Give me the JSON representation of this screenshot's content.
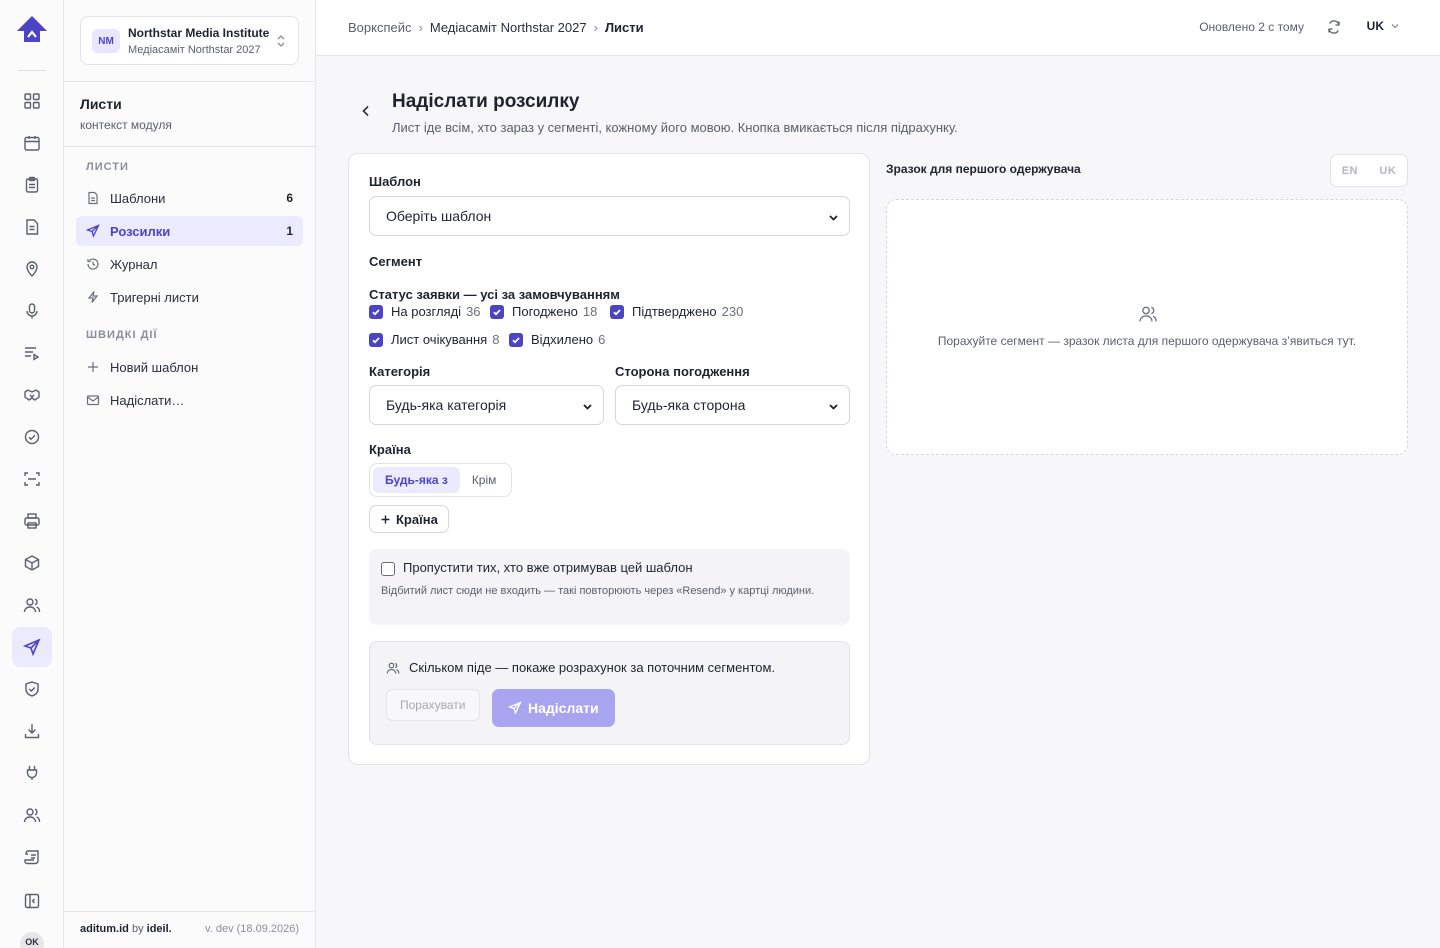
{
  "org": {
    "badge": "NM",
    "name": "Northstar Media Institute",
    "sub": "Медіасаміт Northstar 2027"
  },
  "module": {
    "title": "Листи",
    "subtitle": "контекст модуля"
  },
  "sidebar": {
    "group1": "ЛИСТИ",
    "items": [
      {
        "label": "Шаблони",
        "count": "6"
      },
      {
        "label": "Розсилки",
        "count": "1"
      },
      {
        "label": "Журнал",
        "count": ""
      },
      {
        "label": "Тригерні листи",
        "count": ""
      }
    ],
    "group2": "ШВИДКІ ДІЇ",
    "quick": [
      {
        "label": "Новий шаблон"
      },
      {
        "label": "Надіслати…"
      }
    ],
    "footer": {
      "brand": "aditum.id",
      "by": "by",
      "maker": "ideil.",
      "version": "v. dev (18.09.2026)"
    }
  },
  "rail": {
    "avatar": "OK"
  },
  "topbar": {
    "crumbs": [
      "Воркспейс",
      "Медіасаміт Northstar 2027",
      "Листи"
    ],
    "updated": "Оновлено 2 с тому",
    "lang": "UK"
  },
  "page": {
    "title": "Надіслати розсилку",
    "subtitle": "Лист іде всім, хто зараз у сегменті, кожному його мовою. Кнопка вмикається після підрахунку."
  },
  "form": {
    "template_label": "Шаблон",
    "template_value": "Оберіть шаблон",
    "segment_label": "Сегмент",
    "status_label": "Статус заявки — усі за замовчуванням",
    "statuses": [
      {
        "label": "На розгляді",
        "count": "36"
      },
      {
        "label": "Погоджено",
        "count": "18"
      },
      {
        "label": "Підтверджено",
        "count": "230"
      },
      {
        "label": "Лист очікування",
        "count": "8"
      },
      {
        "label": "Відхилено",
        "count": "6"
      }
    ],
    "category_label": "Категорія",
    "category_value": "Будь-яка категорія",
    "side_label": "Сторона погодження",
    "side_value": "Будь-яка сторона",
    "country_label": "Країна",
    "country_options": [
      "Будь-яка з",
      "Крім"
    ],
    "add_country": "Країна",
    "skip_label": "Пропустити тих, хто вже отримував цей шаблон",
    "skip_hint": "Відбитий лист сюди не входить — такі повторюють через «Resend» у картці людини.",
    "calc_info": "Скільком піде — покаже розрахунок за поточним сегментом.",
    "count_button": "Порахувати",
    "send_button": "Надіслати"
  },
  "preview": {
    "title": "Зразок для першого одержувача",
    "langs": [
      "EN",
      "UK"
    ],
    "empty": "Порахуйте сегмент — зразок листа для першого одержувача з’явиться тут."
  },
  "colors": {
    "accent": "#4b45c6",
    "accent_soft": "#ebeaff",
    "send_disabled": "#a8a4f0"
  }
}
